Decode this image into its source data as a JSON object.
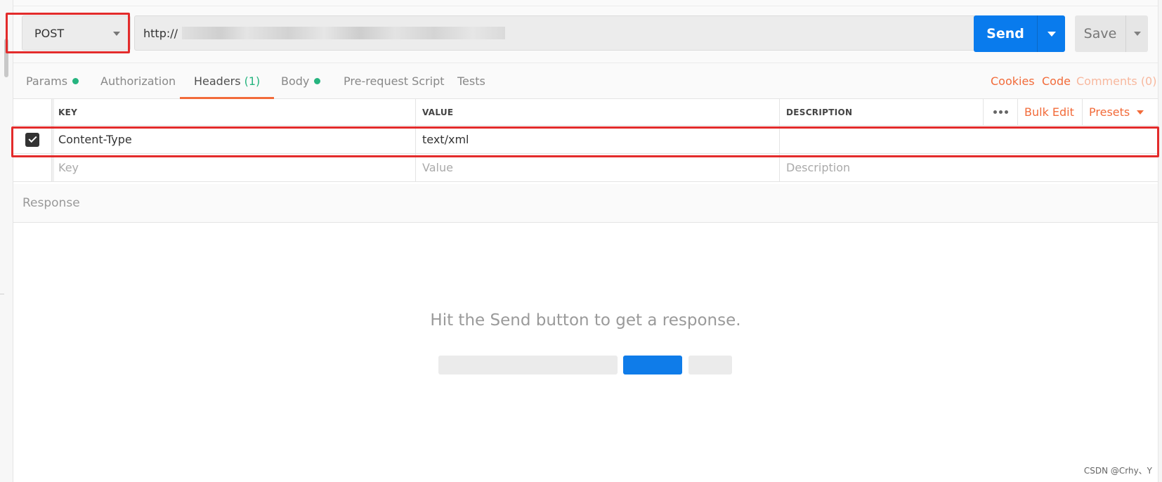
{
  "request": {
    "method": "POST",
    "url_prefix": "http://",
    "send_label": "Send",
    "save_label": "Save"
  },
  "tabs": [
    {
      "label": "Params",
      "dot": true
    },
    {
      "label": "Authorization"
    },
    {
      "label": "Headers",
      "count": "(1)",
      "active": true
    },
    {
      "label": "Body",
      "dot": true
    },
    {
      "label": "Pre-request Script"
    },
    {
      "label": "Tests"
    }
  ],
  "tab_links": {
    "cookies": "Cookies",
    "code": "Code",
    "comments": "Comments (0)"
  },
  "headers_table": {
    "columns": {
      "key": "KEY",
      "value": "VALUE",
      "description": "DESCRIPTION"
    },
    "bulk_edit": "Bulk Edit",
    "presets": "Presets",
    "rows": [
      {
        "checked": true,
        "key": "Content-Type",
        "value": "text/xml",
        "description": ""
      }
    ],
    "placeholders": {
      "key": "Key",
      "value": "Value",
      "description": "Description"
    }
  },
  "response": {
    "title": "Response",
    "empty_message": "Hit the Send button to get a response."
  },
  "watermark": "CSDN @Crhy、Y",
  "colors": {
    "accent_orange": "#f26b3a",
    "send_blue": "#097bed",
    "highlight_red": "#e32b2b",
    "status_green": "#26b47f"
  }
}
